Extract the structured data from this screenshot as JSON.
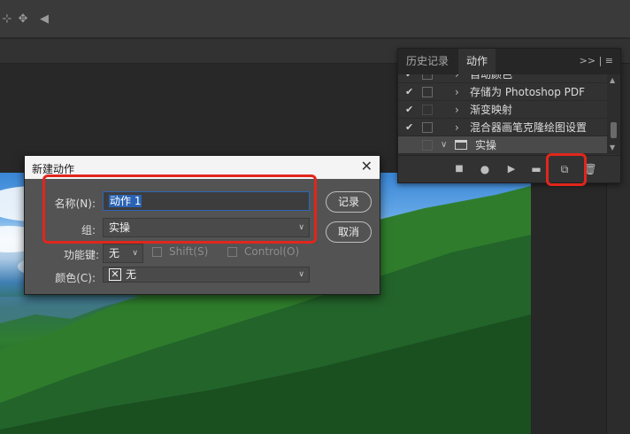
{
  "actions_panel": {
    "tabs": [
      {
        "label": "历史记录"
      },
      {
        "label": "动作"
      }
    ],
    "tab_icons": ">> | ≡",
    "rows": [
      {
        "label": "自动颜色"
      },
      {
        "label": "存储为 Photoshop PDF"
      },
      {
        "label": "渐变映射"
      },
      {
        "label": "混合器画笔克隆绘图设置"
      },
      {
        "label": "实操"
      }
    ]
  },
  "dialog": {
    "title": "新建动作",
    "name_label": "名称(N):",
    "name_value": "动作 1",
    "set_label": "组:",
    "set_value": "实操",
    "function_key_label": "功能键:",
    "function_key_value": "无",
    "shift_label": "Shift(S)",
    "control_label": "Control(O)",
    "color_label": "颜色(C):",
    "color_value": "无",
    "record_button": "记录",
    "cancel_button": "取消"
  },
  "colors": {
    "highlight": "#e1261c",
    "accent": "#2a63b4"
  }
}
